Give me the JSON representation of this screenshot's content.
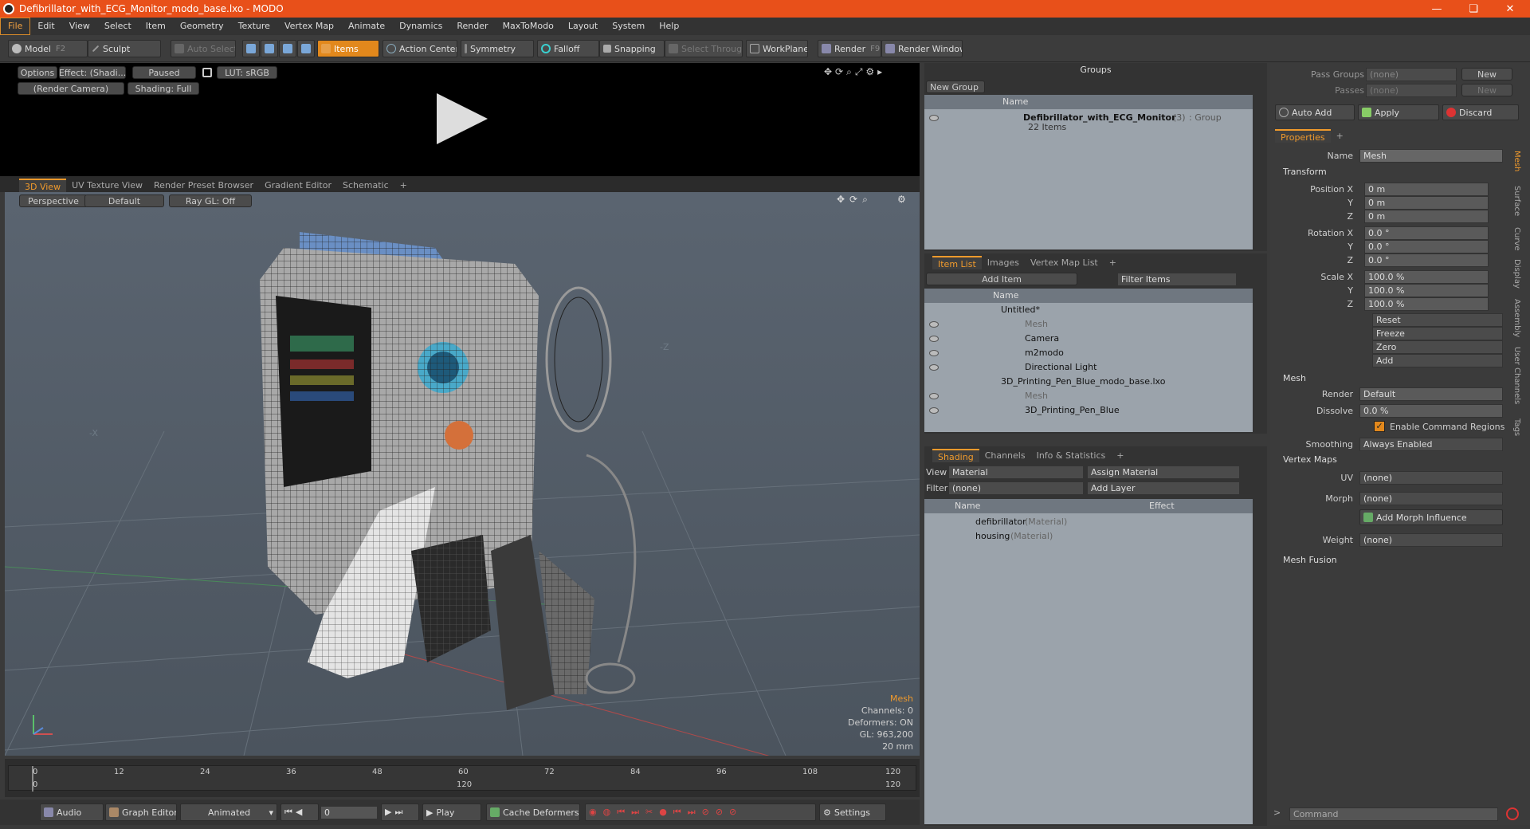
{
  "window": {
    "title": "Defibrillator_with_ECG_Monitor_modo_base.lxo - MODO"
  },
  "menu": [
    "File",
    "Edit",
    "View",
    "Select",
    "Item",
    "Geometry",
    "Texture",
    "Vertex Map",
    "Animate",
    "Dynamics",
    "Render",
    "MaxToModo",
    "Layout",
    "System",
    "Help"
  ],
  "toolbar": {
    "model": "Model",
    "model_key": "F2",
    "sculpt": "Sculpt",
    "auto_select": "Auto Select",
    "items": "Items",
    "action_center": "Action Center",
    "symmetry": "Symmetry",
    "falloff": "Falloff",
    "snapping": "Snapping",
    "select_through": "Select Through",
    "workplane": "WorkPlane",
    "render": "Render",
    "render_key": "F9",
    "render_window": "Render Window"
  },
  "preview": {
    "options": "Options",
    "effect": "Effect: (Shadi...",
    "paused": "Paused",
    "lut": "LUT: sRGB",
    "camera": "(Render Camera)",
    "shading": "Shading: Full"
  },
  "viewport_tabs": [
    "3D View",
    "UV Texture View",
    "Render Preset Browser",
    "Gradient Editor",
    "Schematic"
  ],
  "viewport": {
    "perspective": "Perspective",
    "default": "Default",
    "raygl": "Ray GL: Off",
    "axis_neg_z": "-Z",
    "axis_neg_x": "-X",
    "info": [
      "Mesh",
      "Channels: 0",
      "Deformers: ON",
      "GL: 963,200",
      "20 mm"
    ]
  },
  "timeline": {
    "ticks": [
      "0",
      "12",
      "24",
      "36",
      "48",
      "60",
      "72",
      "84",
      "96",
      "108",
      "120"
    ],
    "end_top": "120",
    "mid_bottom": "120",
    "end_bottom": "120"
  },
  "bottom_bar": {
    "audio": "Audio",
    "graph_editor": "Graph Editor",
    "animated": "Animated",
    "frame": "0",
    "play": "Play",
    "cache": "Cache Deformers",
    "settings": "Settings"
  },
  "groups": {
    "title": "Groups",
    "new_group": "New Group",
    "col_name": "Name",
    "item_name": "Defibrillator_with_ECG_Monitor",
    "item_count": "(3)",
    "item_type": ": Group",
    "item_sub": "22 Items"
  },
  "item_list": {
    "tabs": [
      "Item List",
      "Images",
      "Vertex Map List"
    ],
    "add_item": "Add Item",
    "filter": "Filter Items",
    "col_name": "Name",
    "rows": [
      "Untitled*",
      "Mesh",
      "Camera",
      "m2modo",
      "Directional Light",
      "3D_Printing_Pen_Blue_modo_base.lxo",
      "Mesh",
      "3D_Printing_Pen_Blue"
    ]
  },
  "shading": {
    "tabs": [
      "Shading",
      "Channels",
      "Info & Statistics"
    ],
    "view_label": "View",
    "view_value": "Material",
    "assign": "Assign Material",
    "filter_label": "Filter",
    "filter_value": "(none)",
    "add_layer": "Add Layer",
    "col_name": "Name",
    "col_effect": "Effect",
    "rows": [
      {
        "name": "defibrillator",
        "type": "(Material)"
      },
      {
        "name": "housing",
        "type": "(Material)"
      }
    ]
  },
  "right": {
    "pass_groups": "Pass Groups",
    "passes": "Passes",
    "none": "(none)",
    "new": "New",
    "auto_add": "Auto Add",
    "apply": "Apply",
    "discard": "Discard",
    "properties_tab": "Properties",
    "name_label": "Name",
    "name_value": "Mesh",
    "transform": "Transform",
    "pos_label": "Position X",
    "y": "Y",
    "z": "Z",
    "pos": [
      "0 m",
      "0 m",
      "0 m"
    ],
    "rot_label": "Rotation X",
    "rot": [
      "0.0 °",
      "0.0 °",
      "0.0 °"
    ],
    "scale_label": "Scale X",
    "scale": [
      "100.0 %",
      "100.0 %",
      "100.0 %"
    ],
    "reset": "Reset",
    "freeze": "Freeze",
    "zero": "Zero",
    "add": "Add",
    "mesh": "Mesh",
    "render_label": "Render",
    "render_value": "Default",
    "dissolve_label": "Dissolve",
    "dissolve_value": "0.0 %",
    "enable_cmd": "Enable Command Regions",
    "smoothing_label": "Smoothing",
    "smoothing_value": "Always Enabled",
    "vertex_maps": "Vertex Maps",
    "uv_label": "UV",
    "morph_label": "Morph",
    "add_morph": "Add Morph Influence",
    "weight_label": "Weight",
    "mesh_fusion": "Mesh Fusion",
    "command": "Command",
    "side_tabs": [
      "Mesh",
      "Surface",
      "Curve",
      "Display",
      "Assembly",
      "User Channels",
      "Tags"
    ]
  },
  "colors": {
    "accent": "#f09a2c",
    "title_bar": "#e8501a"
  }
}
